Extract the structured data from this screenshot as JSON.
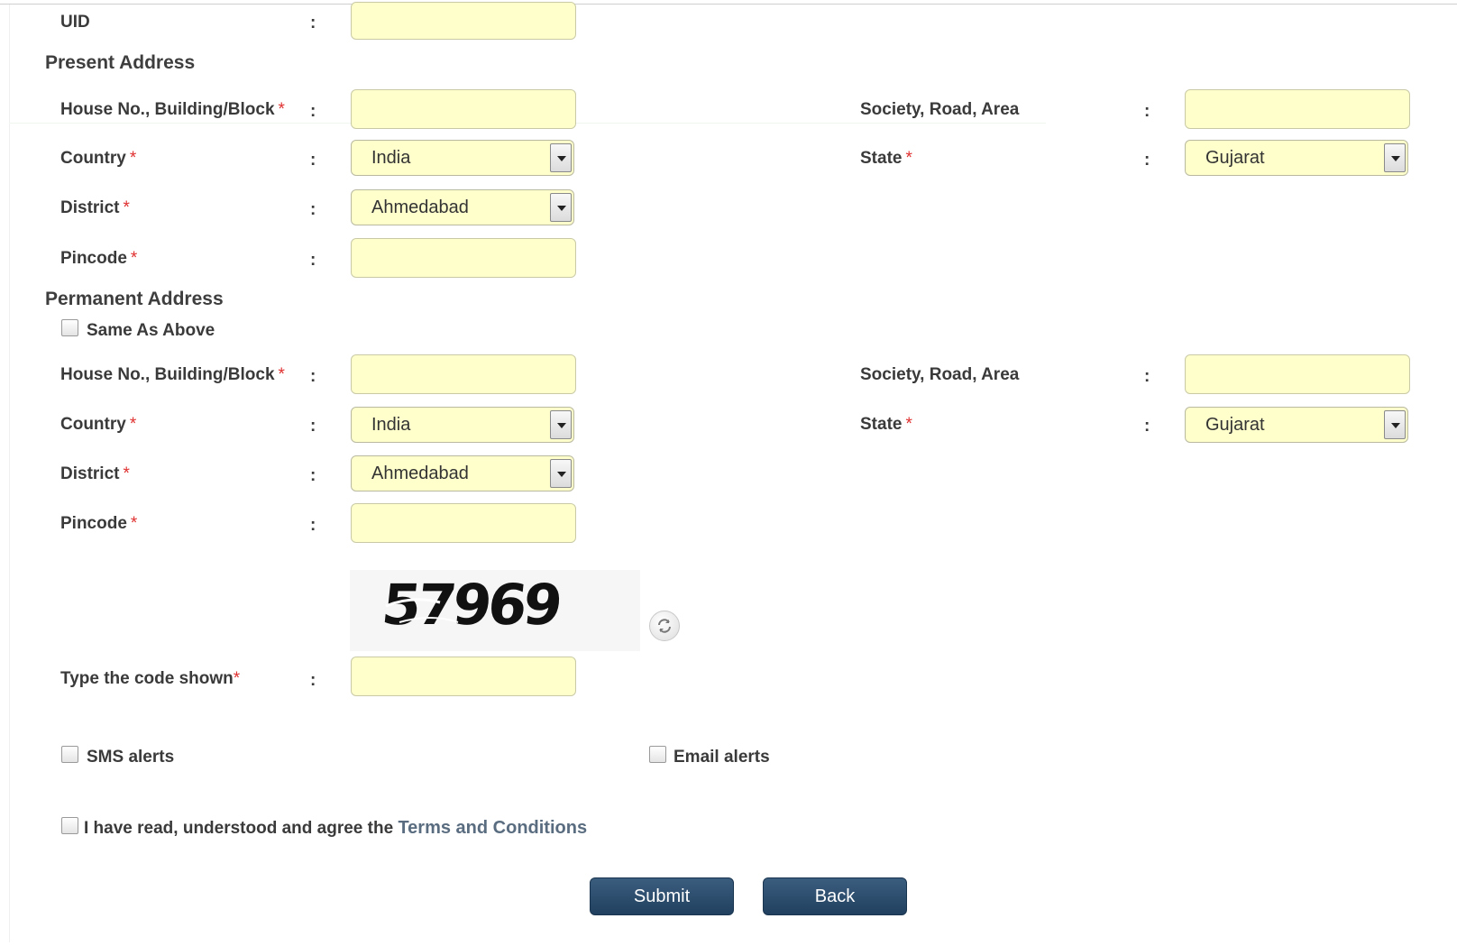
{
  "uid": {
    "label": "UID",
    "colon": ":"
  },
  "present": {
    "heading": "Present Address",
    "house_label": "House No., Building/Block",
    "society_label": "Society, Road, Area",
    "country_label": "Country",
    "country_value": "India",
    "state_label": "State",
    "state_value": "Gujarat",
    "district_label": "District",
    "district_value": "Ahmedabad",
    "pincode_label": "Pincode"
  },
  "permanent": {
    "heading": "Permanent Address",
    "same_as_above": "Same As Above",
    "house_label": "House No., Building/Block",
    "society_label": "Society, Road, Area",
    "country_label": "Country",
    "country_value": "India",
    "state_label": "State",
    "state_value": "Gujarat",
    "district_label": "District",
    "district_value": "Ahmedabad",
    "pincode_label": "Pincode"
  },
  "captcha": {
    "code": "57969",
    "type_label": "Type the code shown"
  },
  "alerts": {
    "sms_label": "SMS alerts",
    "email_label": "Email alerts"
  },
  "terms": {
    "prefix": "I have read, understood and agree the",
    "link": "Terms and Conditions"
  },
  "buttons": {
    "submit": "Submit",
    "back": "Back"
  },
  "required_mark": "*",
  "colors": {
    "field_bg": "#ffffcc",
    "button_bg": "#2b4a6a",
    "required": "#e03030"
  }
}
